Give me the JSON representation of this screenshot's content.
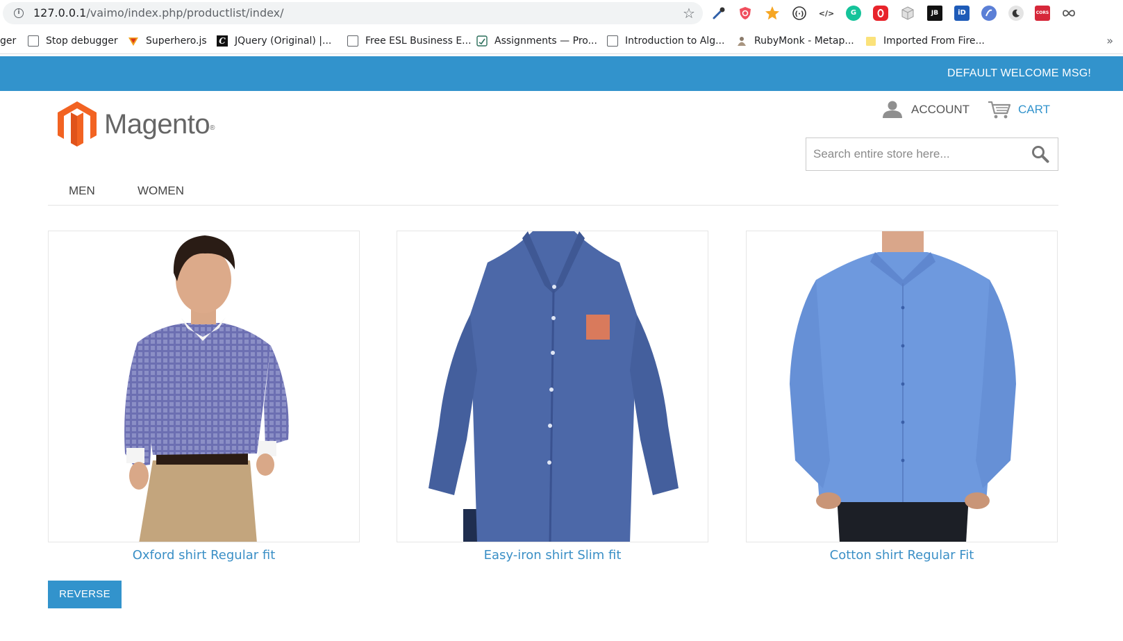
{
  "browser": {
    "url_host": "127.0.0.1",
    "url_path": "/vaimo/index.php/productlist/index/",
    "bookmarks": [
      {
        "label": "ger"
      },
      {
        "label": "Stop debugger"
      },
      {
        "label": "Superhero.js"
      },
      {
        "label": "JQuery (Original) |..."
      },
      {
        "label": "Free ESL Business E..."
      },
      {
        "label": "Assignments — Pro..."
      },
      {
        "label": "Introduction to Alg..."
      },
      {
        "label": "RubyMonk - Metap..."
      },
      {
        "label": "Imported From Fire..."
      }
    ],
    "more_glyph": "»",
    "extension_labels": {
      "jb": "JB",
      "id": "iD",
      "cors": "CORS",
      "code": "</>"
    }
  },
  "header": {
    "welcome": "DEFAULT WELCOME MSG!",
    "logo_text": "Magento",
    "logo_mark": "®",
    "account": "ACCOUNT",
    "cart": "CART",
    "search_placeholder": "Search entire store here..."
  },
  "nav": {
    "items": [
      "MEN",
      "WOMEN"
    ]
  },
  "products": [
    {
      "name": "Oxford shirt Regular fit"
    },
    {
      "name": "Easy-iron shirt Slim fit"
    },
    {
      "name": "Cotton shirt Regular Fit"
    }
  ],
  "actions": {
    "reverse": "REVERSE"
  },
  "colors": {
    "brand_blue": "#3293cc",
    "magento_orange": "#f26322"
  }
}
